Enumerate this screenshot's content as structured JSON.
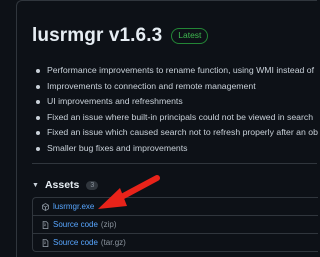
{
  "release": {
    "title": "lusrmgr v1.6.3",
    "badge": "Latest"
  },
  "notes": [
    "Performance improvements to rename function, using WMI instead of",
    "Improvements to connection and remote management",
    "UI improvements and refreshments",
    "Fixed an issue where built-in principals could not be viewed in search",
    "Fixed an issue which caused search not to refresh properly after an ob",
    "Smaller bug fixes and improvements"
  ],
  "assets": {
    "label": "Assets",
    "count": "3",
    "items": [
      {
        "name": "lusrmgr.exe",
        "ext": "",
        "icon": "package-icon"
      },
      {
        "name": "Source code",
        "ext": "(zip)",
        "icon": "file-zip-icon"
      },
      {
        "name": "Source code",
        "ext": "(tar.gz)",
        "icon": "file-zip-icon"
      }
    ]
  },
  "colors": {
    "background": "#0d1117",
    "link": "#58a6ff",
    "latest_badge": "#3fb950",
    "annotation_arrow": "#e8231a"
  }
}
